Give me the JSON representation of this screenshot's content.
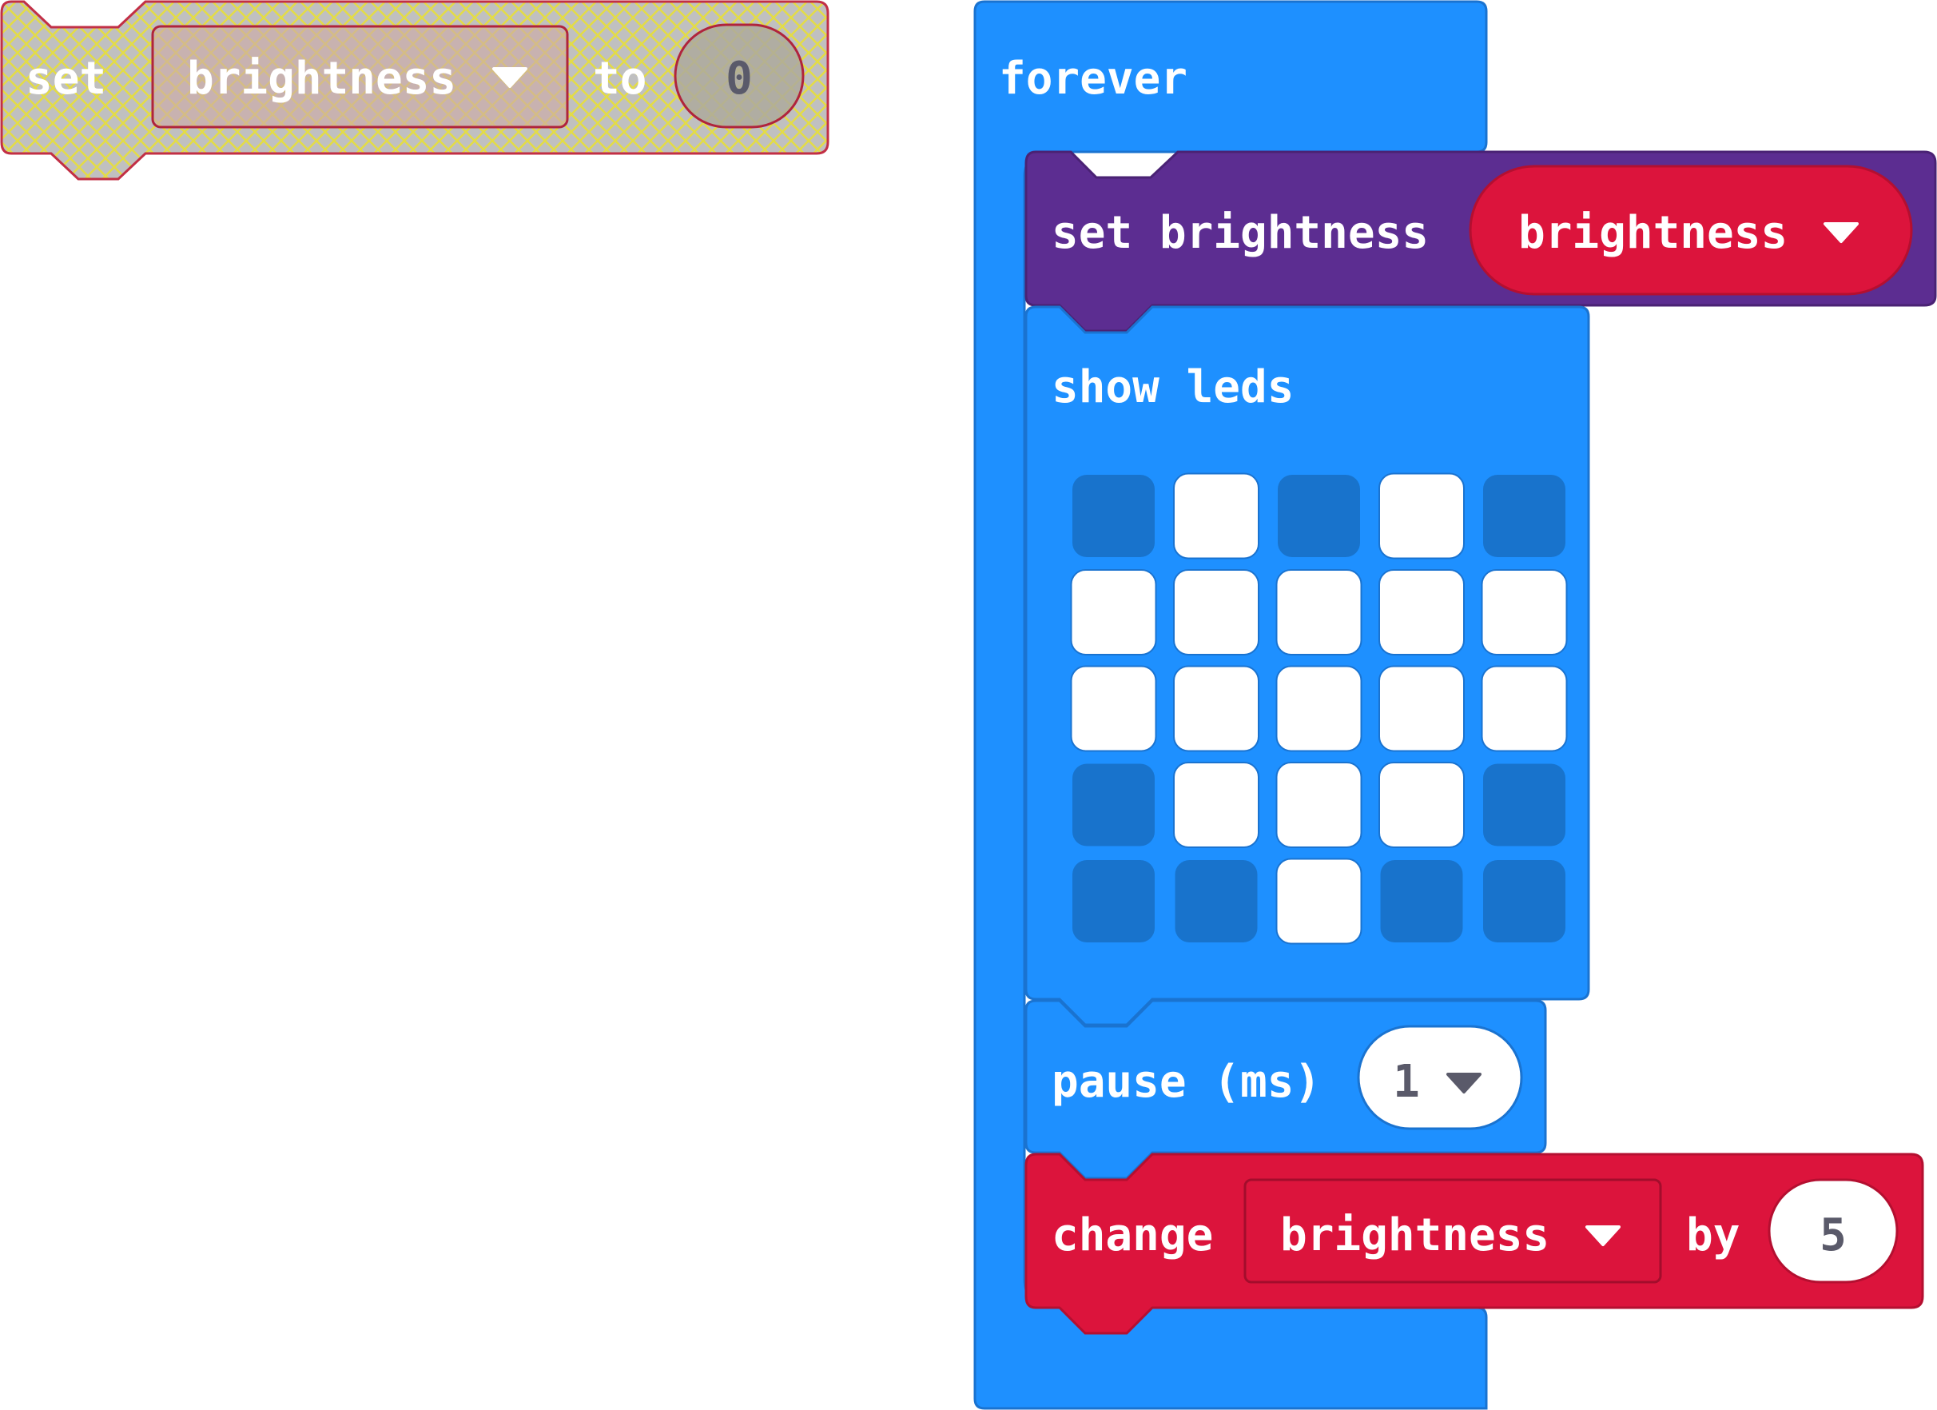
{
  "orphan_block": {
    "set_word": "set",
    "variable": "brightness",
    "to_word": "to",
    "value": "0",
    "colors": {
      "fill": "#c0c0c0",
      "hatch": "#e6e04a",
      "outline": "#c22f45"
    }
  },
  "forever_block": {
    "label": "forever",
    "color": "#1e90ff",
    "border": "#1a73d0"
  },
  "set_brightness_block": {
    "label": "set brightness",
    "value": "brightness",
    "color": "#5c2d91",
    "value_color": "#dc143c"
  },
  "show_leds_block": {
    "label": "show leds",
    "grid": [
      [
        0,
        1,
        0,
        1,
        0
      ],
      [
        1,
        1,
        1,
        1,
        1
      ],
      [
        1,
        1,
        1,
        1,
        1
      ],
      [
        0,
        1,
        1,
        1,
        0
      ],
      [
        0,
        0,
        1,
        0,
        0
      ]
    ],
    "on_color": "#ffffff",
    "off_color": "#1873cc"
  },
  "pause_block": {
    "label": "pause (ms)",
    "value": "1"
  },
  "change_block": {
    "change_word": "change",
    "variable": "brightness",
    "by_word": "by",
    "value": "5",
    "color": "#dc143c"
  },
  "icons": {
    "dropdown": "triangle-down"
  }
}
